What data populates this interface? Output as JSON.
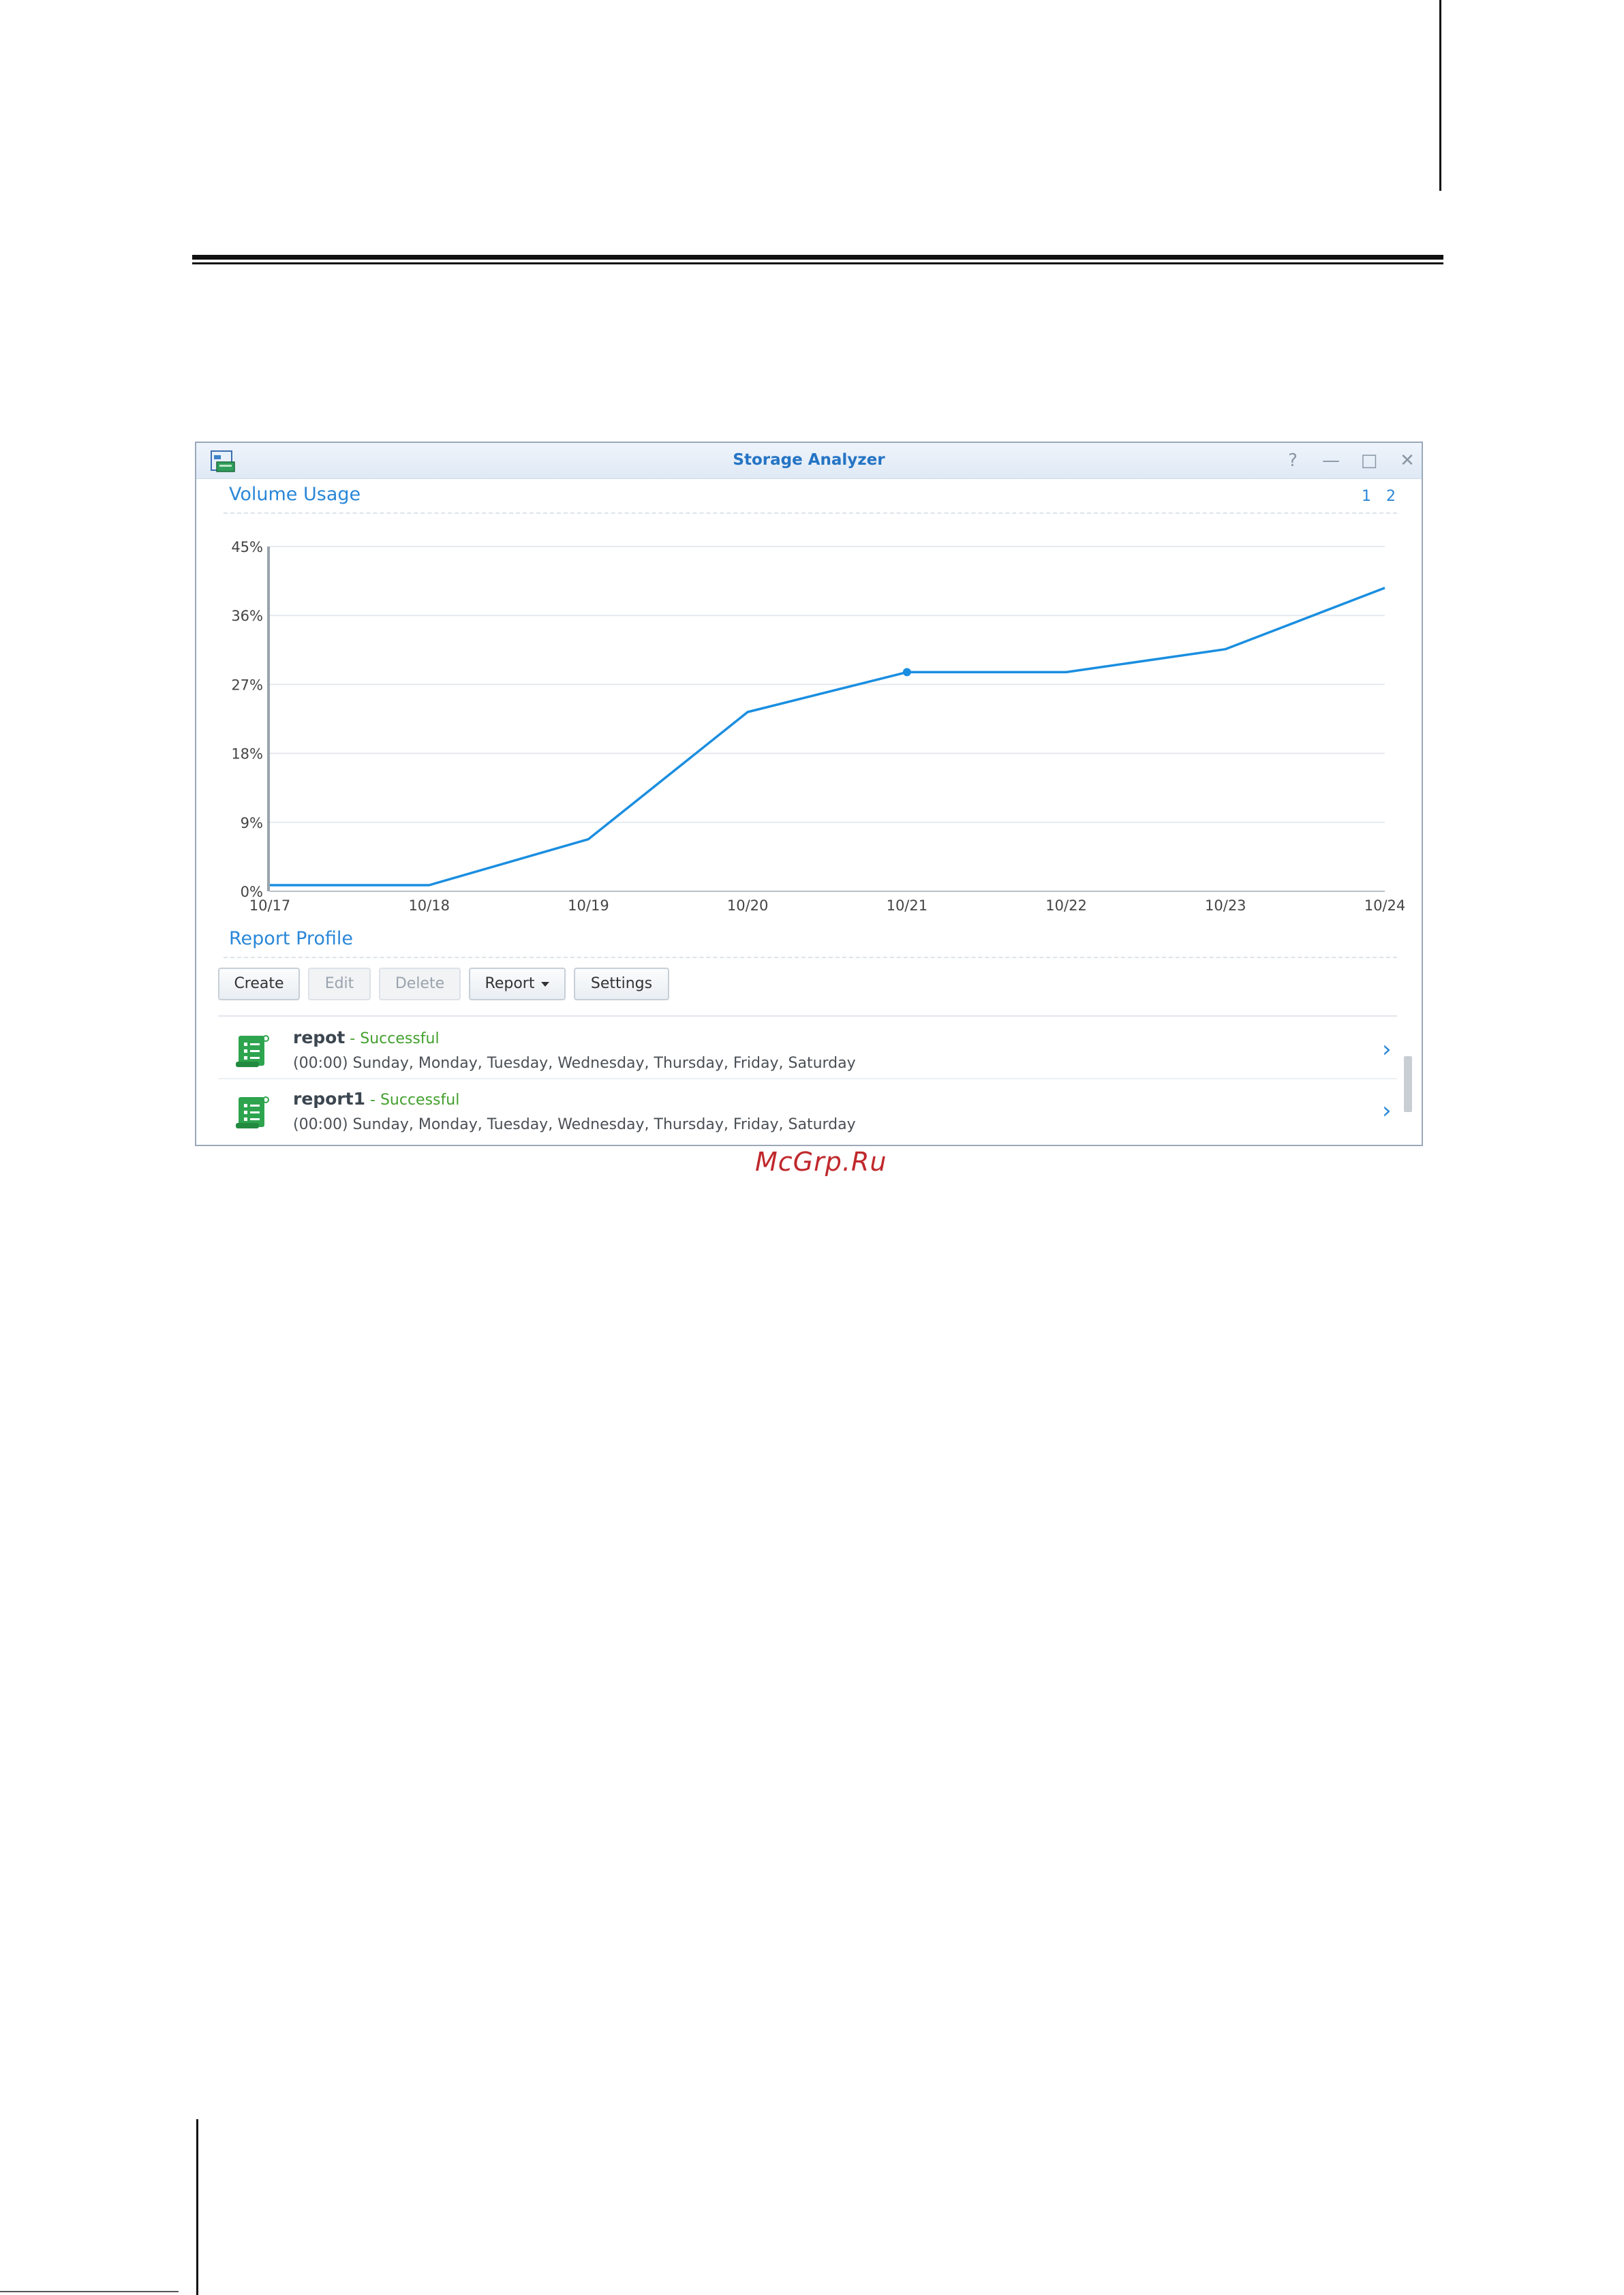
{
  "window": {
    "title": "Storage Analyzer",
    "controls": {
      "help": "?",
      "minimize": "—",
      "maximize": "□",
      "close": "✕"
    }
  },
  "volume_usage": {
    "title": "Volume Usage",
    "pages": [
      "1",
      "2"
    ]
  },
  "chart_data": {
    "type": "line",
    "title": "",
    "xlabel": "",
    "ylabel": "",
    "categories": [
      "10/17",
      "10/18",
      "10/19",
      "10/20",
      "10/21",
      "10/22",
      "10/23",
      "10/24"
    ],
    "series": [
      {
        "values": [
          0.8,
          0.8,
          6.8,
          23.4,
          28.6,
          28.6,
          31.6,
          39.6
        ]
      }
    ],
    "yticks": [
      "0%",
      "9%",
      "18%",
      "27%",
      "36%",
      "45%"
    ],
    "ylim": [
      0,
      45
    ],
    "grid": true,
    "highlighted_point": "10/21",
    "color": "#1a8ee0"
  },
  "report_profile": {
    "title": "Report Profile",
    "toolbar": {
      "create": "Create",
      "edit": "Edit",
      "delete": "Delete",
      "report": "Report",
      "settings": "Settings"
    },
    "items": [
      {
        "name": "repot",
        "status": " - Successful",
        "schedule": "(00:00) Sunday, Monday, Tuesday, Wednesday, Thursday, Friday, Saturday"
      },
      {
        "name": "report1",
        "status": " - Successful",
        "schedule": "(00:00) Sunday, Monday, Tuesday, Wednesday, Thursday, Friday, Saturday"
      }
    ]
  },
  "watermark": "McGrp.Ru"
}
